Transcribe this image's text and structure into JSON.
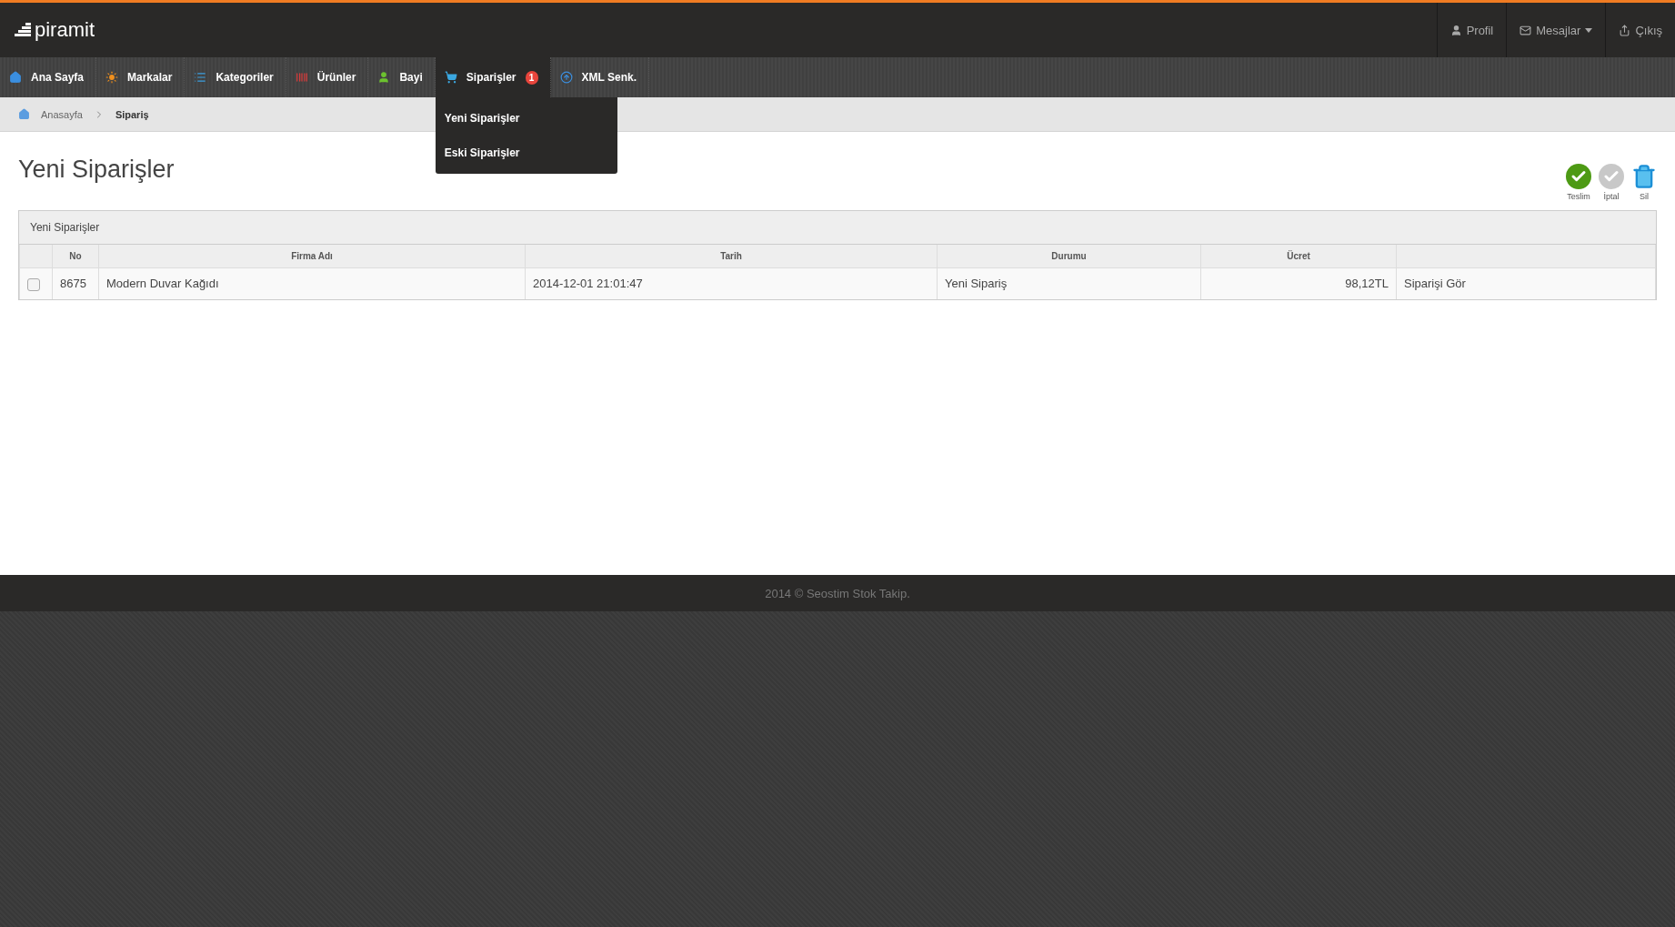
{
  "brand": "piramit",
  "user_menu": [
    {
      "label": "Profil",
      "caret": false
    },
    {
      "label": "Mesajlar",
      "caret": true
    },
    {
      "label": "Çıkış",
      "caret": false
    }
  ],
  "nav": [
    {
      "label": "Ana Sayfa",
      "selected": false
    },
    {
      "label": "Markalar",
      "selected": false
    },
    {
      "label": "Kategoriler",
      "selected": false
    },
    {
      "label": "Ürünler",
      "selected": false
    },
    {
      "label": "Bayi",
      "selected": false
    },
    {
      "label": "Siparişler",
      "selected": true,
      "badge": "1",
      "dropdown": [
        "Yeni Siparişler",
        "Eski Siparişler"
      ]
    },
    {
      "label": "XML Senk.",
      "selected": false
    }
  ],
  "breadcrumb": [
    "Anasayfa",
    "Sipariş"
  ],
  "page_title": "Yeni Siparişler",
  "actions": [
    "Teslim",
    "İptal",
    "Sil"
  ],
  "panel": {
    "title": "Yeni Siparişler",
    "columns": [
      "No",
      "Firma Adı",
      "Tarih",
      "Durumu",
      "Ücret"
    ],
    "rows": [
      {
        "checked": false,
        "no": "8675",
        "firm": "Modern Duvar Kağıdı",
        "date": "2014-12-01 21:01:47",
        "status": "Yeni Sipariş",
        "price": "98,12TL",
        "link": "Siparişi Gör"
      }
    ]
  },
  "footer": "2014 © Seostim Stok Takip."
}
